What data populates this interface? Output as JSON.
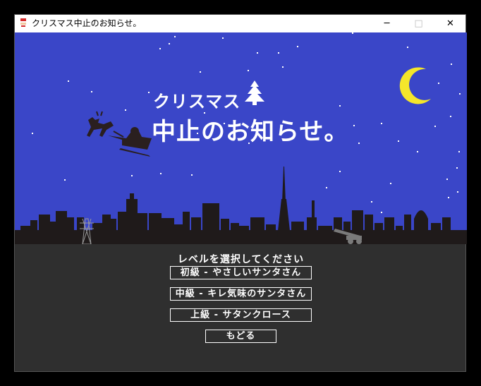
{
  "window": {
    "title": "クリスマス中止のお知らせ。",
    "icon": "santa-icon",
    "controls": {
      "minimize": "─",
      "maximize": "□",
      "close": "✕"
    }
  },
  "scene": {
    "title_line1": "クリスマス",
    "title_line2": "中止のお知らせ。",
    "sky_color": "#3a46c8",
    "moon_color": "#f5e62a",
    "ground_color": "#2f2f2f",
    "silhouette_color": "#1f1a1a"
  },
  "menu": {
    "heading": "レベルを選択してください",
    "buttons": [
      "初級 - やさしいサンタさん",
      "中級 - キレ気味のサンタさん",
      "上級 - サタンクロース",
      "もどる"
    ]
  }
}
